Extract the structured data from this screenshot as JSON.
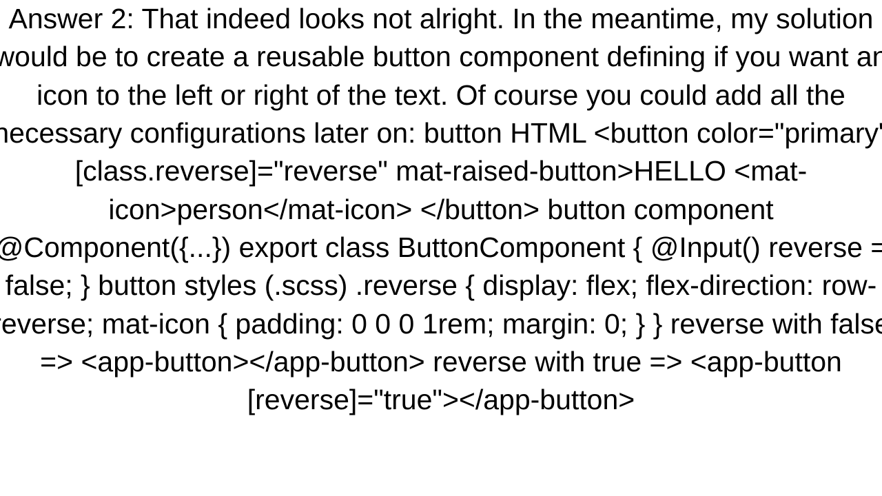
{
  "answer": {
    "text": "Answer 2: That indeed looks not alright. In the meantime, my solution would be to create a reusable button component defining if you want an icon to the left or right of the text. Of course you could add all the necessary configurations later on: button HTML <button   color=\"primary\"   [class.reverse]=\"reverse\"    mat-raised-button>HELLO   <mat-icon>person</mat-icon> </button>  button component @Component({...}) export class ButtonComponent {   @Input() reverse = false; }  button styles (.scss) .reverse {   display: flex;   flex-direction: row-reverse;    mat-icon {     padding: 0 0 0 1rem;     margin: 0;   } }  reverse with false => <app-button></app-button>  reverse with true => <app-button [reverse]=\"true\"></app-button>"
  }
}
